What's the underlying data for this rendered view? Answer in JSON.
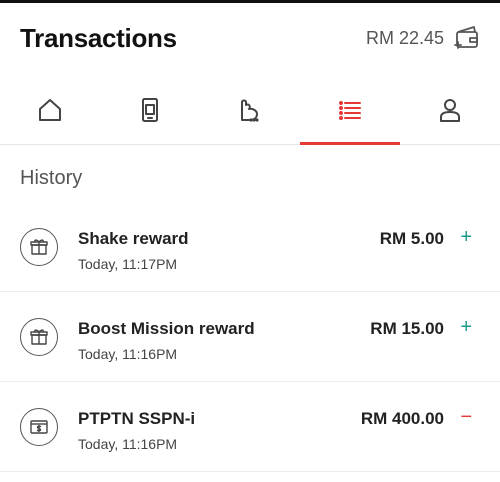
{
  "header": {
    "title": "Transactions",
    "balance": "RM 22.45"
  },
  "nav": {
    "items": [
      {
        "icon": "home-icon"
      },
      {
        "icon": "phone-icon"
      },
      {
        "icon": "bag-icon"
      },
      {
        "icon": "list-icon",
        "active": true
      },
      {
        "icon": "profile-icon"
      }
    ],
    "active_color": "#e53935"
  },
  "history": {
    "title": "History",
    "transactions": [
      {
        "icon": "gift-icon",
        "name": "Shake reward",
        "time": "Today, 11:17PM",
        "amount": "RM 5.00",
        "sign": "+"
      },
      {
        "icon": "gift-icon",
        "name": "Boost Mission reward",
        "time": "Today, 11:16PM",
        "amount": "RM 15.00",
        "sign": "+"
      },
      {
        "icon": "card-dollar-icon",
        "name": "PTPTN SSPN-i",
        "time": "Today, 11:16PM",
        "amount": "RM 400.00",
        "sign": "−"
      }
    ]
  },
  "colors": {
    "credit": "#1a9a8a",
    "debit": "#e53935"
  }
}
